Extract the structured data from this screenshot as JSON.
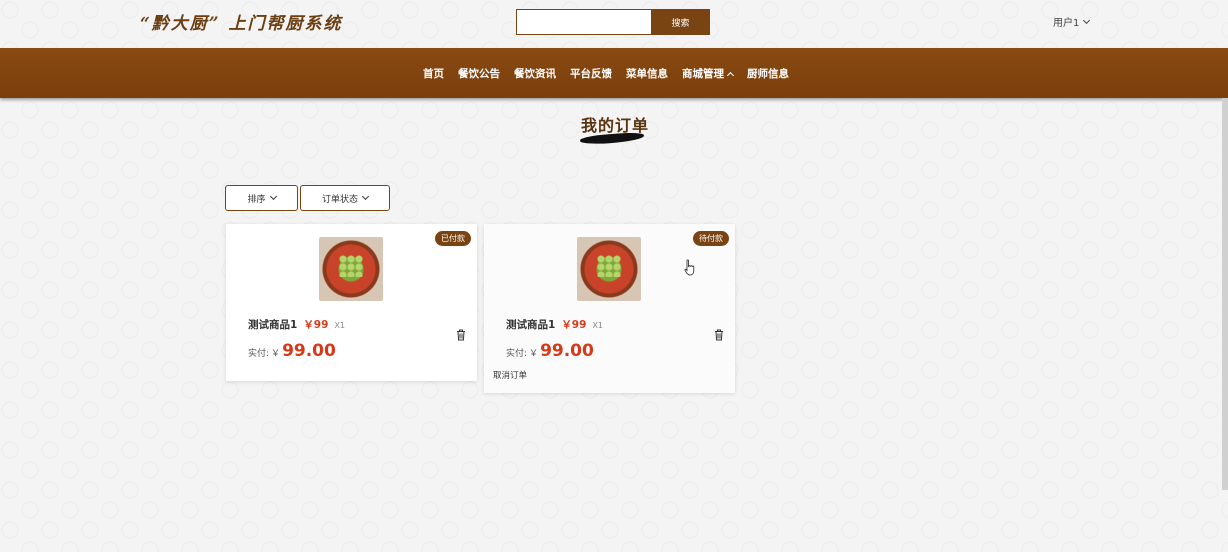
{
  "header": {
    "site_title": "“黔大厨” 上门帮厨系统",
    "search_placeholder": "",
    "search_button": "搜索",
    "user_label": "用户1"
  },
  "nav": {
    "items": [
      "首页",
      "餐饮公告",
      "餐饮资讯",
      "平台反馈",
      "菜单信息",
      "商城管理",
      "厨师信息"
    ]
  },
  "page": {
    "heading": "我的订单",
    "filters": {
      "sort_label": "排序",
      "status_label": "订单状态"
    }
  },
  "orders": [
    {
      "status": "已付款",
      "product_name": "测试商品1",
      "unit_price": "￥99",
      "quantity": "X1",
      "paid_label": "实付:",
      "currency": "￥",
      "amount": "99.00",
      "cancel_label": ""
    },
    {
      "status": "待付款",
      "product_name": "测试商品1",
      "unit_price": "￥99",
      "quantity": "X1",
      "paid_label": "实付:",
      "currency": "￥",
      "amount": "99.00",
      "cancel_label": "取消订单"
    }
  ],
  "colors": {
    "brand_brown": "#7a4412",
    "price_red": "#d43a1a"
  },
  "icons": [
    "chevron-down-icon",
    "chevron-up-icon",
    "trash-icon",
    "pointer-cursor-icon"
  ]
}
